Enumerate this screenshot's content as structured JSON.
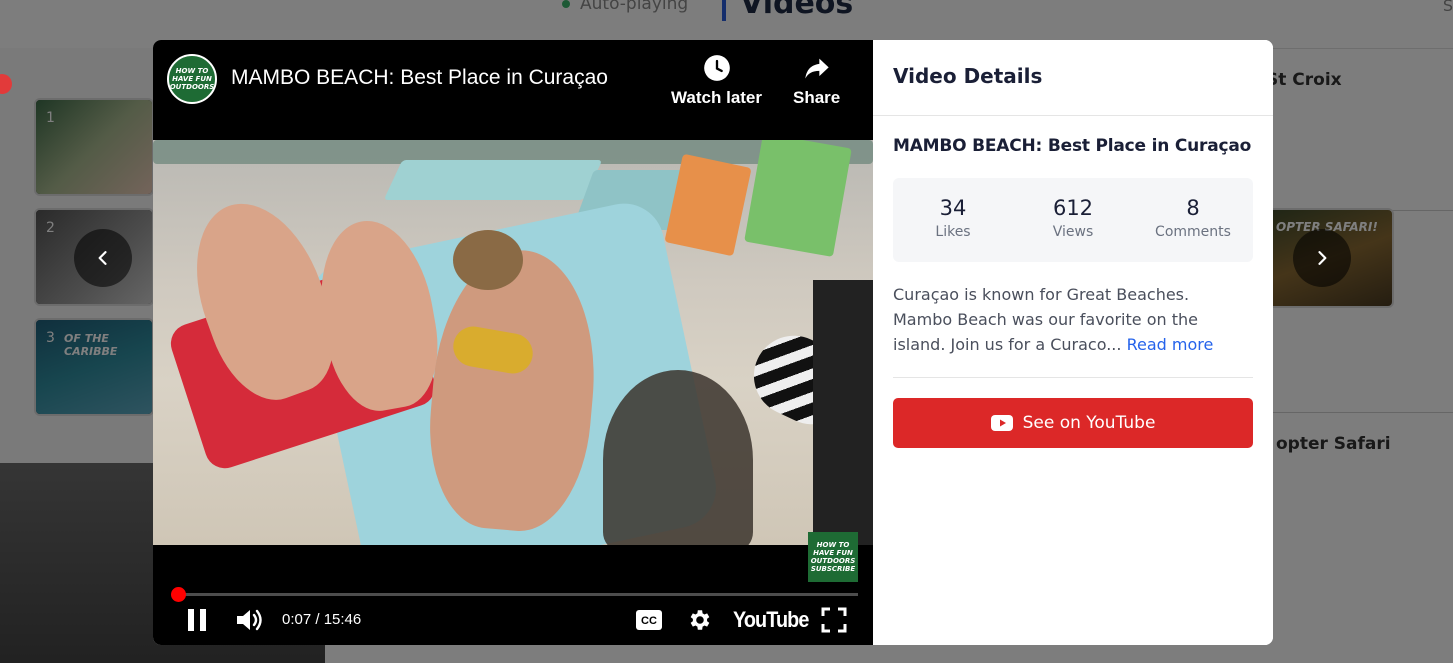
{
  "background": {
    "autoplay_label": "Auto-playing",
    "section_title": "Videos",
    "corner_text": "S",
    "playlist": [
      {
        "num": "1"
      },
      {
        "num": "2"
      },
      {
        "num": "3",
        "caption": "OF THE CARIBBE"
      }
    ],
    "right_titles": [
      "St Croix",
      "opter Safari"
    ],
    "right_thumb_caption": "OPTER SAFARI!"
  },
  "modal": {
    "player": {
      "channel_logo_text": "HOW TO HAVE FUN OUTDOORS",
      "title": "MAMBO BEACH: Best Place in Curaçao",
      "watch_later_label": "Watch later",
      "share_label": "Share",
      "subscribe_badge_text": "HOW TO HAVE FUN OUTDOORS",
      "subscribe_label": "SUBSCRIBE",
      "current_time": "0:07",
      "duration": "15:46",
      "time_display": "0:07 / 15:46",
      "progress_fraction": 0.0075,
      "youtube_wordmark": "YouTube"
    },
    "details": {
      "header": "Video Details",
      "title": "MAMBO BEACH: Best Place in Curaçao",
      "stats": [
        {
          "value": "34",
          "label": "Likes"
        },
        {
          "value": "612",
          "label": "Views"
        },
        {
          "value": "8",
          "label": "Comments"
        }
      ],
      "description": "Curaçao is known for Great Beaches. Mambo Beach was our favorite on the island. Join us for a Curaco...",
      "read_more_label": "Read more",
      "youtube_button_label": "See on YouTube"
    }
  },
  "colors": {
    "accent_red": "#dc2828",
    "link_blue": "#2563eb",
    "progress_red": "#ff0000"
  }
}
